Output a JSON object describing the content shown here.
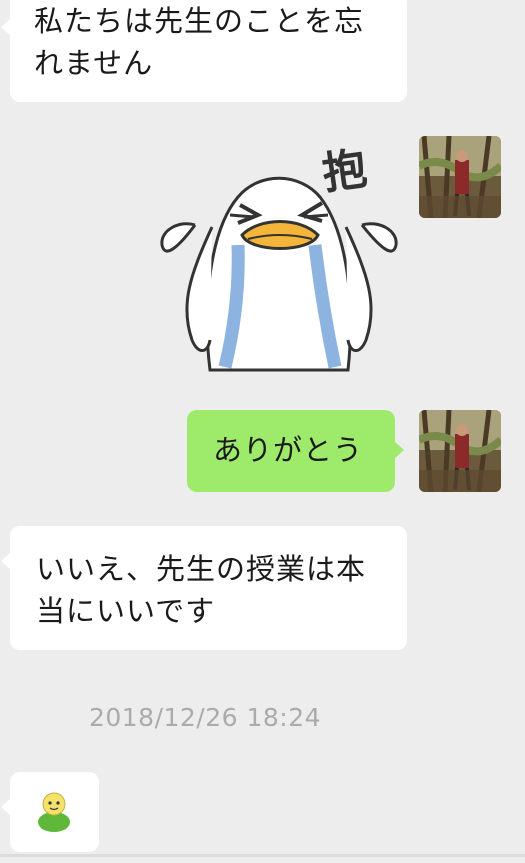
{
  "chat": {
    "messages": [
      {
        "id": "msg1",
        "side": "left",
        "text": "私たちは先生のことを忘れません"
      },
      {
        "id": "sticker",
        "side": "right",
        "type": "sticker",
        "caption": "抱",
        "icon": "crying-duck-hug-sticker"
      },
      {
        "id": "msg2",
        "side": "right",
        "text": "ありがとう"
      },
      {
        "id": "msg3",
        "side": "left",
        "text": "いいえ、先生の授業は本当にいいです"
      },
      {
        "id": "msg4",
        "side": "left",
        "type": "emoji",
        "icon": "green-smiley-figure-emoji"
      }
    ],
    "timestamp": "2018/12/26 18:24"
  },
  "colors": {
    "background": "#ededed",
    "bubble_left": "#ffffff",
    "bubble_right": "#9eea6a",
    "timestamp_text": "#ababab"
  },
  "avatars": {
    "self": "forest-photo-avatar"
  }
}
